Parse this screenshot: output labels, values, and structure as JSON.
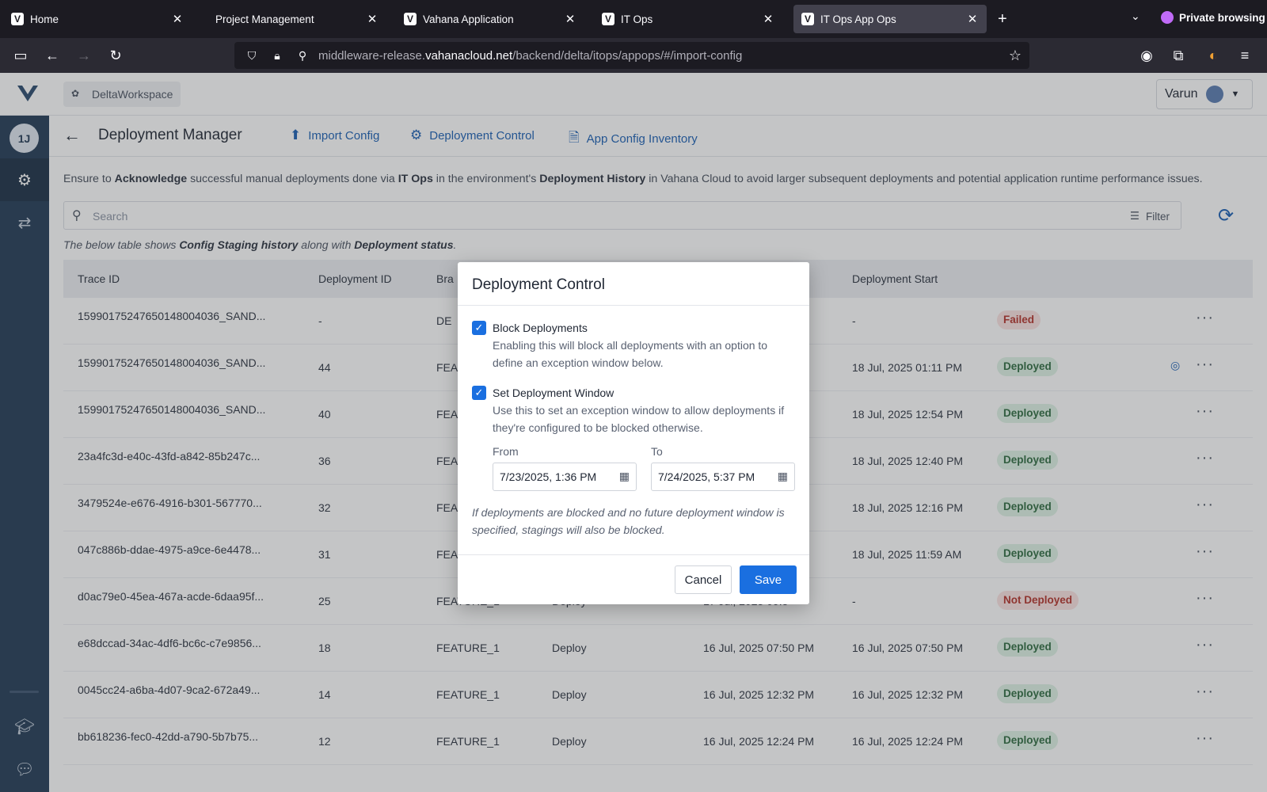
{
  "browser": {
    "tabs": [
      {
        "title": "Home",
        "favicon": "V"
      },
      {
        "title": "Project Management",
        "favicon": ""
      },
      {
        "title": "Vahana Application",
        "favicon": "V"
      },
      {
        "title": "IT Ops",
        "favicon": "V"
      },
      {
        "title": "IT Ops App Ops",
        "favicon": "V"
      }
    ],
    "active_tab": 4,
    "private_label": "Private browsing",
    "url_prefix": "middleware-release.",
    "url_domain": "vahanacloud.net",
    "url_path": "/backend/delta/itops/appops/#/import-config"
  },
  "topbar": {
    "workspace": "DeltaWorkspace",
    "user": "Varun"
  },
  "sidebar": {
    "badge": "1J"
  },
  "header": {
    "title": "Deployment Manager",
    "links": [
      "Import Config",
      "Deployment Control",
      "App Config Inventory"
    ]
  },
  "notice": {
    "p1": "Ensure to ",
    "b1": "Acknowledge",
    "p2": " successful manual deployments done via ",
    "b2": "IT Ops",
    "p3": " in the environment's ",
    "b3": "Deployment History",
    "p4": " in Vahana Cloud to avoid larger subsequent deployments and potential application runtime performance issues."
  },
  "search": {
    "placeholder": "Search",
    "filter_label": "Filter"
  },
  "caption": {
    "p1": "The below table shows ",
    "b1": "Config Staging history",
    "p2": " along with ",
    "b2": "Deployment status",
    "p3": "."
  },
  "table": {
    "headers": [
      "Trace ID",
      "Deployment ID",
      "Bra",
      "",
      "",
      "Deployment Start"
    ],
    "rows": [
      {
        "trace": "1599017524765014800403​6_SAND...",
        "dep_id": "-",
        "branch": "DE",
        "type": "",
        "created": "",
        "start": "-",
        "status": "Failed"
      },
      {
        "trace": "15990175247650148004036_SAND...",
        "dep_id": "44",
        "branch": "FEA",
        "type": "",
        "created": "",
        "start": "18 Jul, 2025 01:11 PM",
        "status": "Deployed"
      },
      {
        "trace": "15990175247650148004036_SAND...",
        "dep_id": "40",
        "branch": "FEA",
        "type": "",
        "created": "",
        "start": "18 Jul, 2025 12:54 PM",
        "status": "Deployed"
      },
      {
        "trace": "23a4fc3d-e40c-43fd-a842-85b247c...",
        "dep_id": "36",
        "branch": "FEA",
        "type": "",
        "created": "",
        "start": "18 Jul, 2025 12:40 PM",
        "status": "Deployed"
      },
      {
        "trace": "3479524e-e676-4916-b301-567770...",
        "dep_id": "32",
        "branch": "FEA",
        "type": "",
        "created": "",
        "start": "18 Jul, 2025 12:16 PM",
        "status": "Deployed"
      },
      {
        "trace": "047c886b-ddae-4975-a9ce-6e4478...",
        "dep_id": "31",
        "branch": "FEA",
        "type": "",
        "created": "",
        "start": "18 Jul, 2025 11:59 AM",
        "status": "Deployed"
      },
      {
        "trace": "d0ac79e0-45ea-467a-acde-6daa95f...",
        "dep_id": "25",
        "branch": "FEATURE_1",
        "type": "Deploy",
        "created": "17 Jul, 2025 09:5",
        "start": "-",
        "status": "Not Deployed"
      },
      {
        "trace": "e68dccad-34ac-4df6-bc6c-c7e9856...",
        "dep_id": "18",
        "branch": "FEATURE_1",
        "type": "Deploy",
        "created": "16 Jul, 2025 07:50 PM",
        "start": "16 Jul, 2025 07:50 PM",
        "status": "Deployed"
      },
      {
        "trace": "0045cc24-a6ba-4d07-9ca2-672a49...",
        "dep_id": "14",
        "branch": "FEATURE_1",
        "type": "Deploy",
        "created": "16 Jul, 2025 12:32 PM",
        "start": "16 Jul, 2025 12:32 PM",
        "status": "Deployed"
      },
      {
        "trace": "bb618236-fec0-42dd-a790-5b7b75...",
        "dep_id": "12",
        "branch": "FEATURE_1",
        "type": "Deploy",
        "created": "16 Jul, 2025 12:24 PM",
        "start": "16 Jul, 2025 12:24 PM",
        "status": "Deployed"
      }
    ]
  },
  "dialog": {
    "title": "Deployment Control",
    "block_label": "Block Deployments",
    "block_desc": "Enabling this will block all deployments with an option to define an exception window below.",
    "block_checked": true,
    "window_label": "Set Deployment Window",
    "window_desc": "Use this to set an exception window to allow deployments if they're configured to be blocked otherwise.",
    "window_checked": true,
    "from_label": "From",
    "from_value": "7/23/2025, 1:36 PM",
    "to_label": "To",
    "to_value": "7/24/2025, 5:37 PM",
    "note": "If deployments are blocked and no future deployment window is specified, stagings will also be blocked.",
    "cancel_label": "Cancel",
    "save_label": "Save"
  },
  "colors": {
    "accent": "#1a6fe0",
    "sidebar": "#223a55",
    "success_bg": "#dff2e5",
    "danger_bg": "#fbe3e1"
  }
}
